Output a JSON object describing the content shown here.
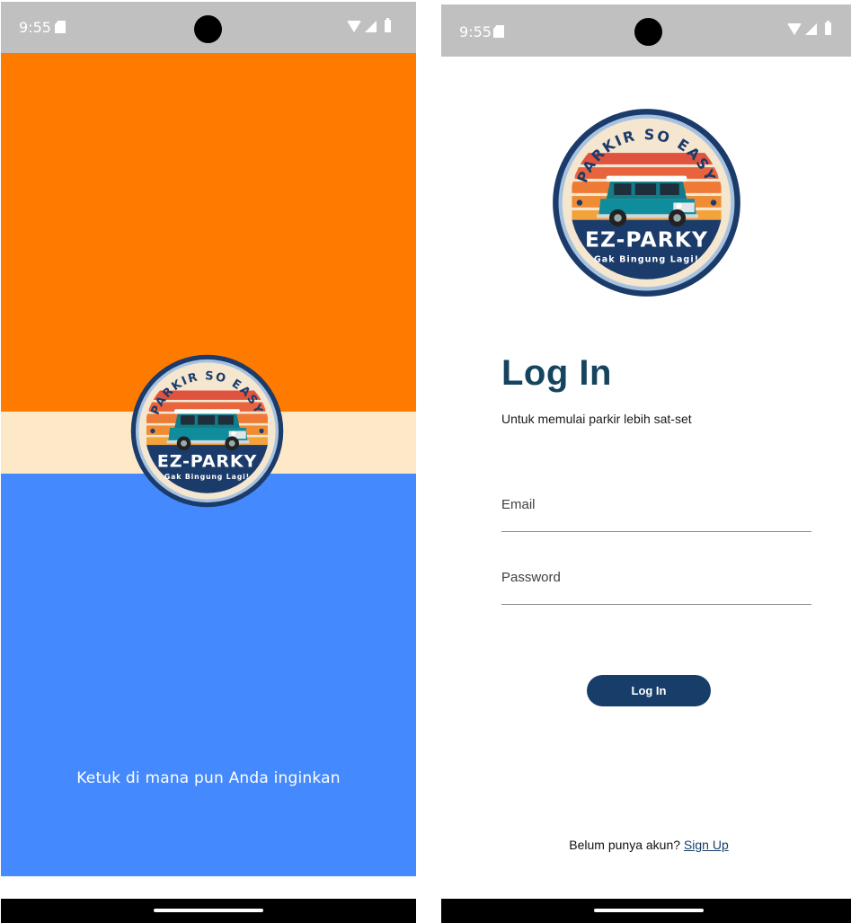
{
  "splash": {
    "status": {
      "time": "9:55"
    },
    "caption": "Ketuk di mana pun Anda inginkan",
    "colors": {
      "top": "#ff7b00",
      "middle": "#fde8c7",
      "bottom": "#4589fe"
    }
  },
  "login": {
    "status": {
      "time": "9:55"
    },
    "title": "Log In",
    "subtitle": "Untuk memulai parkir lebih sat-set",
    "email": {
      "placeholder": "Email",
      "value": ""
    },
    "password": {
      "placeholder": "Password",
      "value": ""
    },
    "submit_label": "Log In",
    "signup_prompt": "Belum punya akun?",
    "signup_link": "Sign Up",
    "colors": {
      "title": "#15445e",
      "button": "#173e69"
    }
  },
  "logo": {
    "top_text": "PARKIR SO EASY",
    "name": "EZ-PARKY",
    "tagline": "Gak Bingung Lagi!"
  }
}
